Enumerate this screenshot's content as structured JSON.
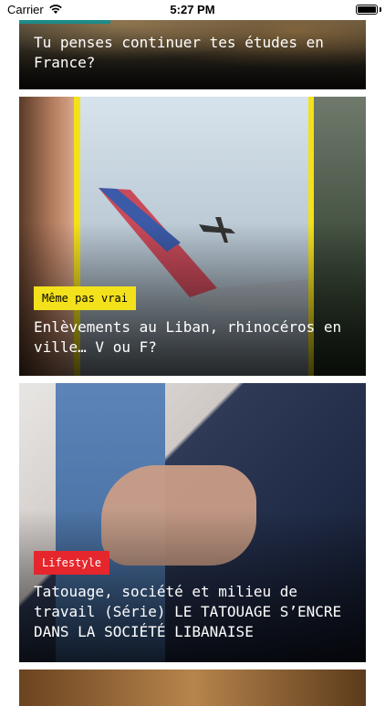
{
  "status_bar": {
    "carrier": "Carrier",
    "time": "5:27 PM",
    "battery_level": 1.0
  },
  "feed": {
    "cards": [
      {
        "title": "Tu penses continuer tes études en France?",
        "tag": "",
        "tag_color": "#1b8c8a"
      },
      {
        "title": "Enlèvements au Liban, rhinocéros en ville… V ou F?",
        "tag": "Même pas vrai",
        "tag_color": "#f3e11b"
      },
      {
        "title": "Tatouage, société et milieu de travail (Série) LE TATOUAGE S’ENCRE DANS LA SOCIÉTÉ LIBANAISE",
        "tag": "Lifestyle",
        "tag_color": "#e5262c"
      },
      {
        "title": "",
        "tag": ""
      }
    ]
  },
  "icons": {
    "wifi": "wifi-icon",
    "battery": "battery-icon"
  }
}
